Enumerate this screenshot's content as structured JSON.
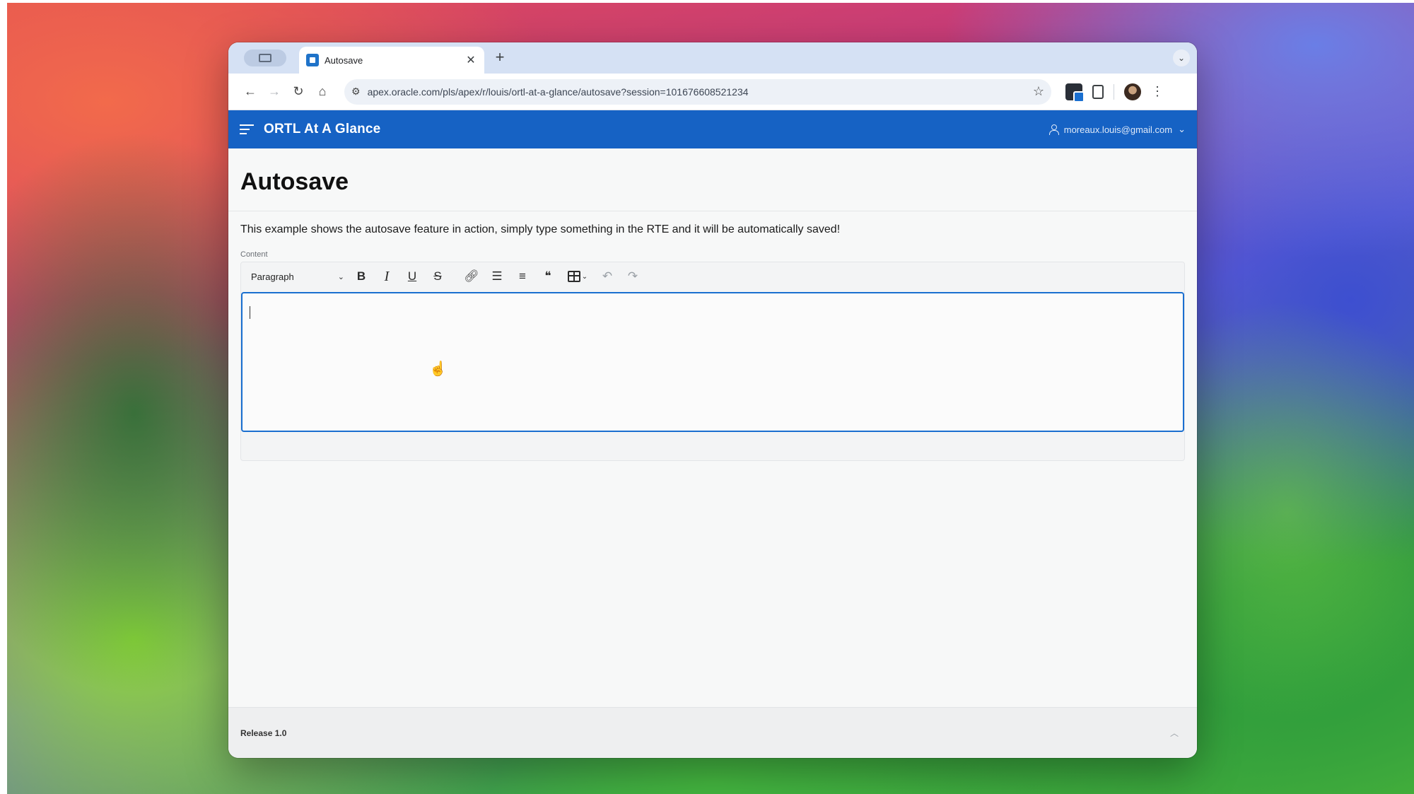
{
  "browser": {
    "tab": {
      "title": "Autosave"
    },
    "new_tab": "+",
    "url": "apex.oracle.com/pls/apex/r/louis/ortl-at-a-glance/autosave?session=101676608521234"
  },
  "app": {
    "title": "ORTL At A Glance",
    "user": "moreaux.louis@gmail.com"
  },
  "page": {
    "title": "Autosave",
    "intro": "This example shows the autosave feature in action, simply type something in the RTE and it will be automatically saved!",
    "field_label": "Content"
  },
  "rte": {
    "format_value": "Paragraph",
    "tools": [
      "bold",
      "italic",
      "underline",
      "strikethrough",
      "link",
      "bulleted-list",
      "numbered-list",
      "blockquote",
      "table",
      "undo",
      "redo"
    ],
    "content": ""
  },
  "footer": {
    "release": "Release 1.0"
  },
  "colors": {
    "app_bar": "#1662c4",
    "editor_focus": "#1a6fd0"
  }
}
